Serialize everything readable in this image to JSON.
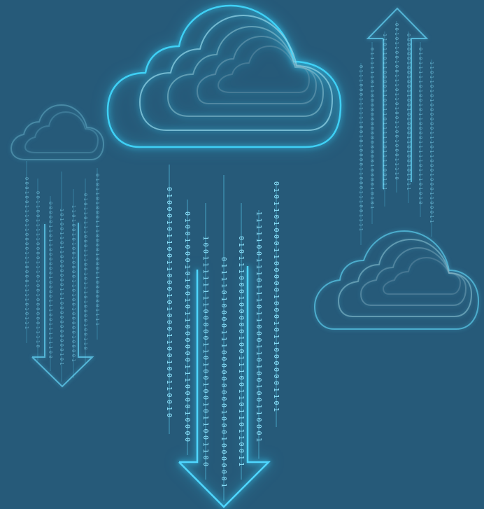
{
  "scene": {
    "background": "#265a79",
    "accent": "#3fd0f5",
    "elements": [
      "large-cloud-icon",
      "small-cloud-icon-left",
      "cloud-icon-right",
      "download-arrow-icon-center",
      "download-arrow-icon-left",
      "upload-arrow-icon-right",
      "binary-streams"
    ]
  }
}
